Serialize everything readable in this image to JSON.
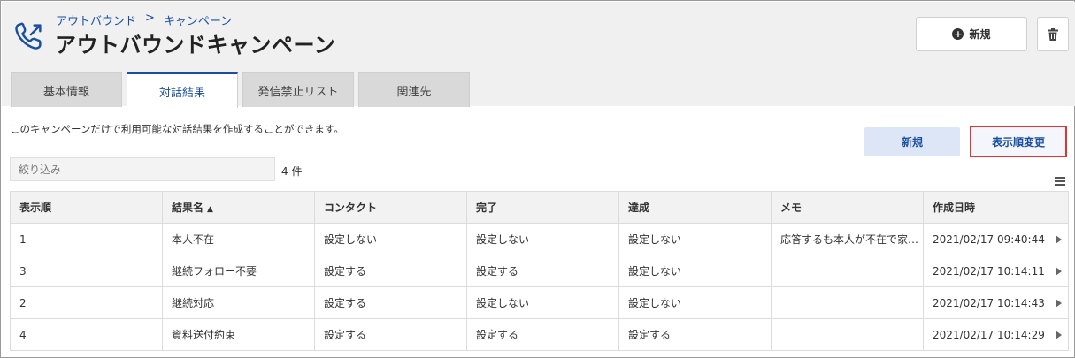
{
  "breadcrumb": [
    "アウトバウンド",
    "キャンペーン"
  ],
  "breadcrumb_separator": ">",
  "title": "アウトバウンドキャンペーン",
  "header_buttons": {
    "new_label": "新規"
  },
  "tabs": [
    {
      "label": "基本情報",
      "active": false
    },
    {
      "label": "対話結果",
      "active": true
    },
    {
      "label": "発信禁止リスト",
      "active": false
    },
    {
      "label": "関連先",
      "active": false
    }
  ],
  "description": "このキャンペーンだけで利用可能な対話結果を作成することができます。",
  "actions": {
    "new_label": "新規",
    "reorder_label": "表示順変更"
  },
  "filter": {
    "placeholder": "絞り込み"
  },
  "count_text": "4 件",
  "table": {
    "columns": [
      "表示順",
      "結果名",
      "コンタクト",
      "完了",
      "達成",
      "メモ",
      "作成日時"
    ],
    "sort_column": "結果名",
    "sort_direction": "asc",
    "rows": [
      [
        "1",
        "本人不在",
        "設定しない",
        "設定しない",
        "設定しない",
        "応答するも本人が不在で家…",
        "2021/02/17 09:40:44"
      ],
      [
        "3",
        "継続フォロー不要",
        "設定する",
        "設定する",
        "設定しない",
        "",
        "2021/02/17 10:14:11"
      ],
      [
        "2",
        "継続対応",
        "設定する",
        "設定しない",
        "設定しない",
        "",
        "2021/02/17 10:14:43"
      ],
      [
        "4",
        "資料送付約束",
        "設定する",
        "設定する",
        "設定する",
        "",
        "2021/02/17 10:14:29"
      ]
    ]
  },
  "colors": {
    "accent": "#1a4fa0",
    "highlight_border": "#e3342f",
    "light_button": "#dce6f7"
  }
}
